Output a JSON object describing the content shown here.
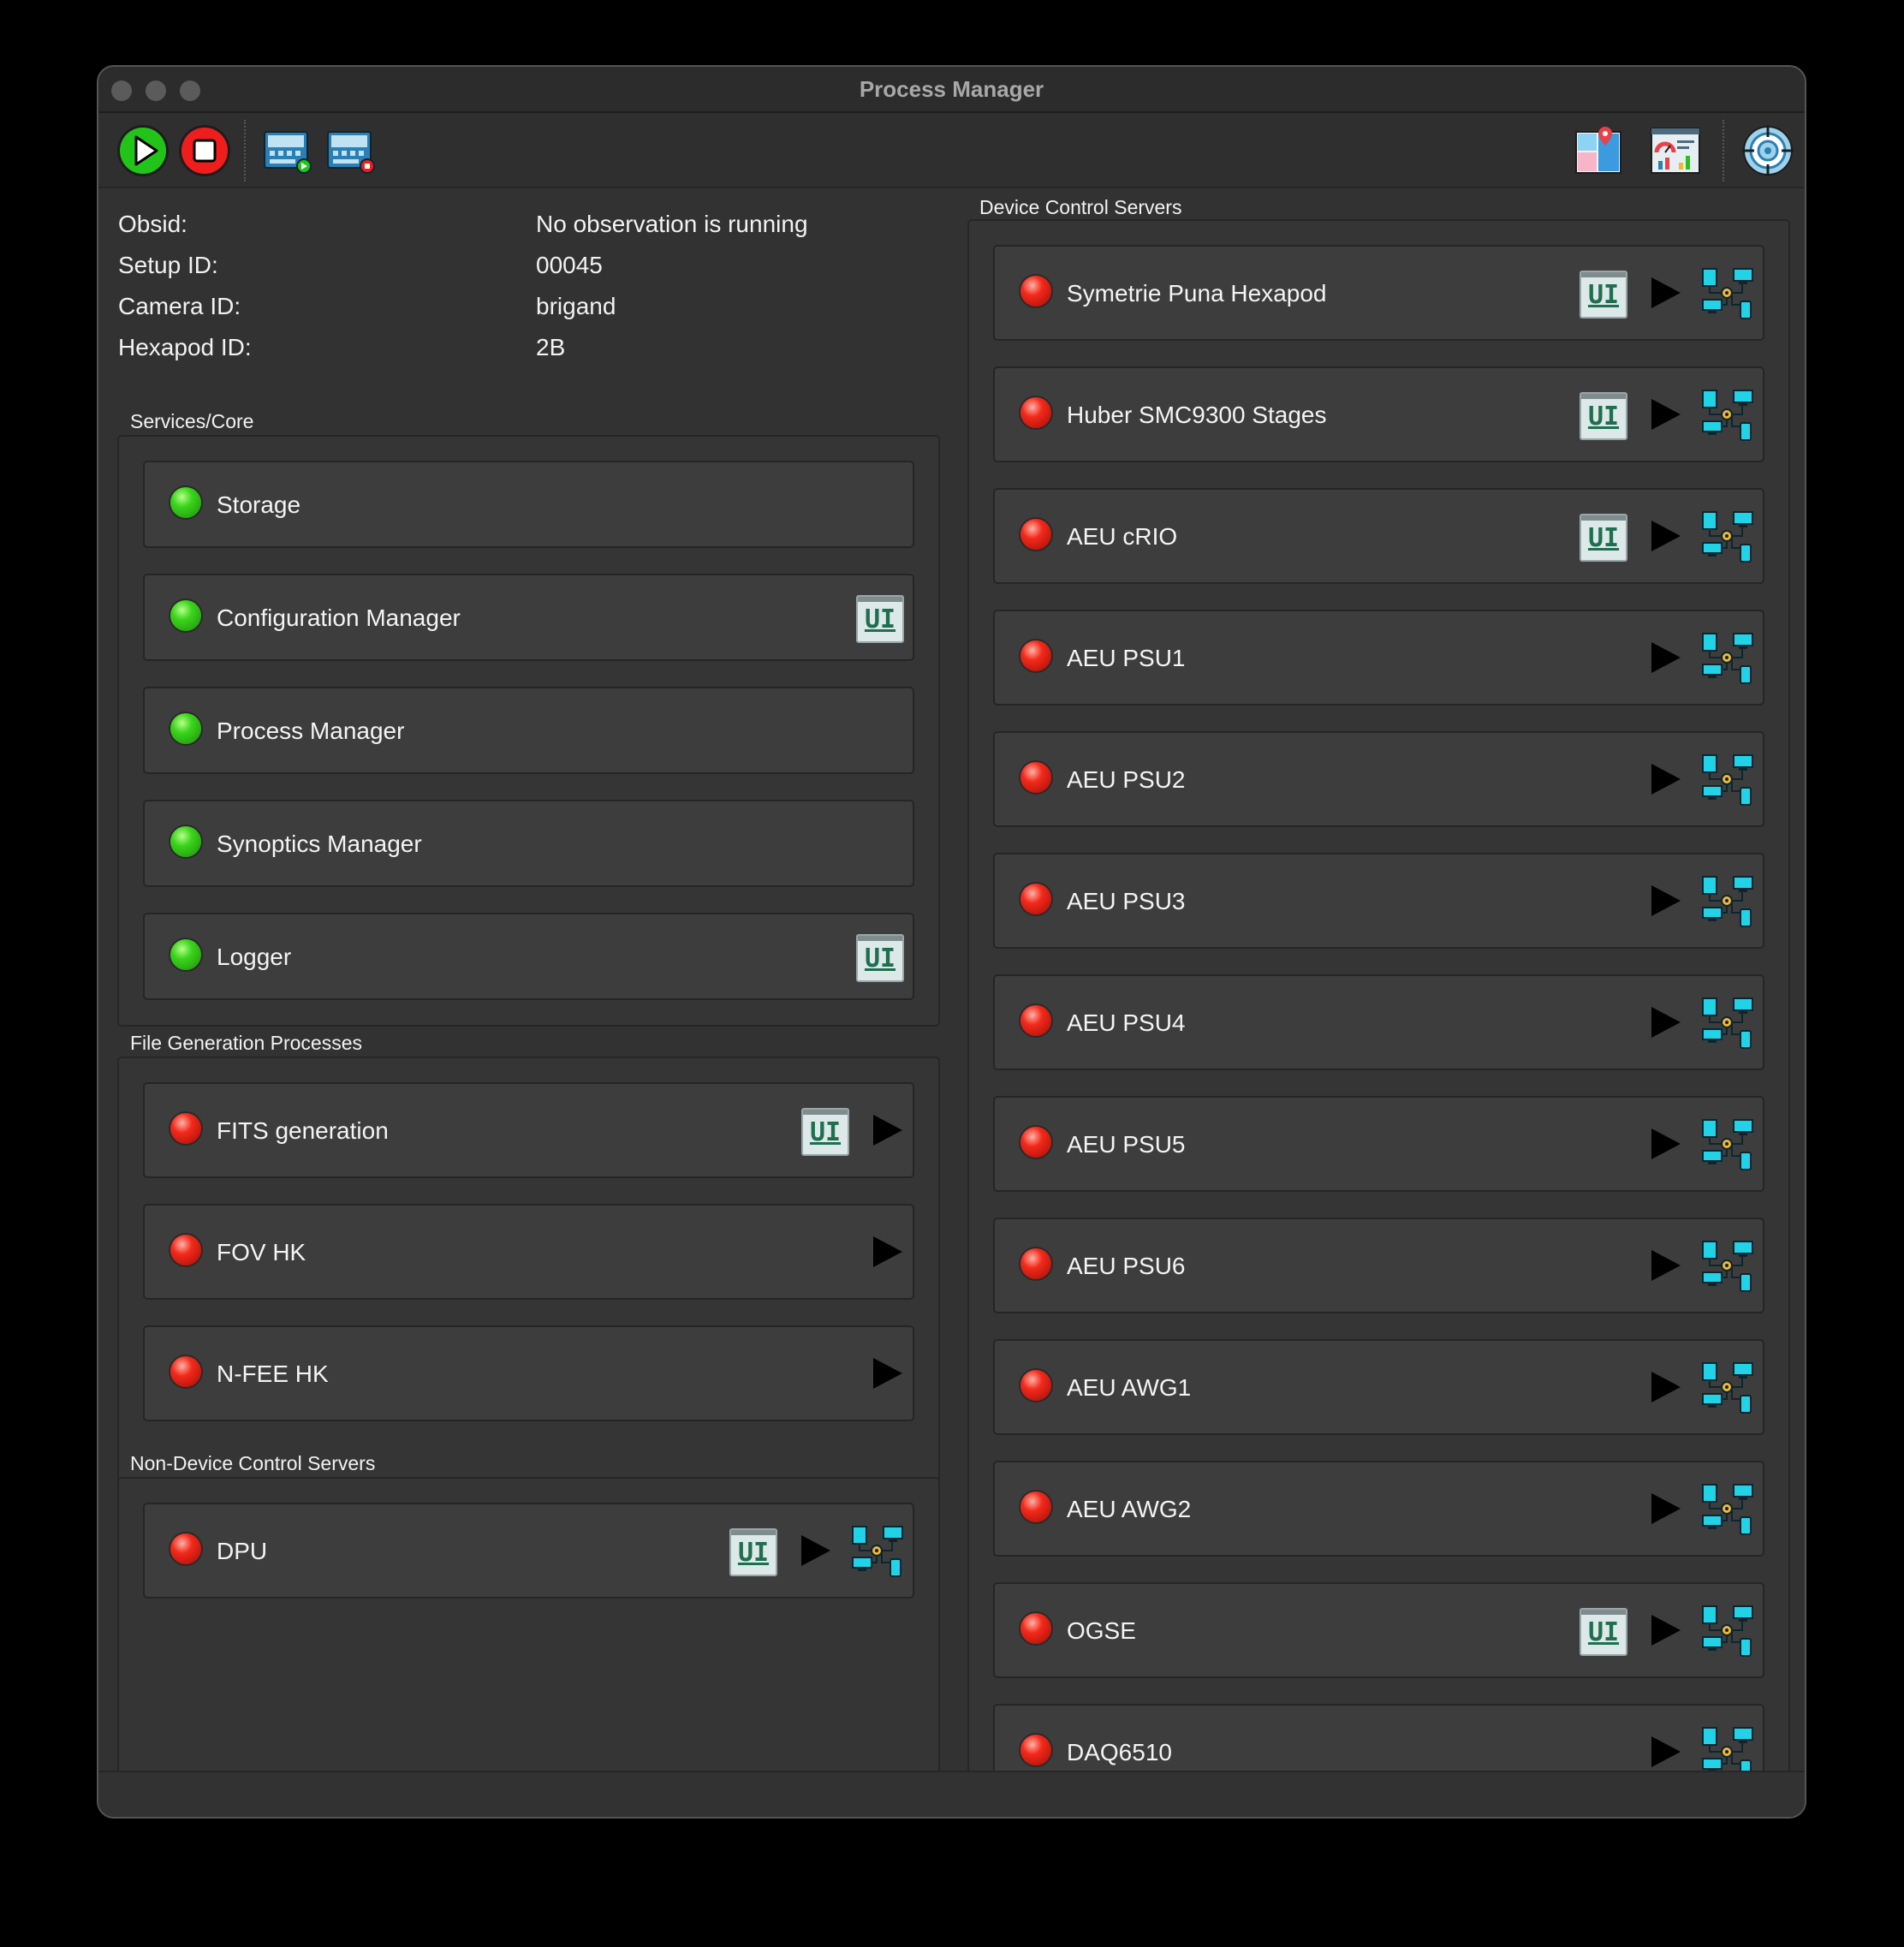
{
  "window": {
    "title": "Process Manager"
  },
  "toolbar": {
    "left_icons": [
      "play-icon",
      "stop-icon",
      "start-all-icon",
      "stop-all-icon"
    ],
    "right_icons": [
      "map-icon",
      "dashboard-icon",
      "target-icon"
    ]
  },
  "info": [
    {
      "label": "Obsid:",
      "value": "No observation is running"
    },
    {
      "label": "Setup ID:",
      "value": "00045"
    },
    {
      "label": "Camera ID:",
      "value": "brigand"
    },
    {
      "label": "Hexapod ID:",
      "value": "2B"
    }
  ],
  "groups": {
    "core": {
      "title": "Services/Core",
      "items": [
        {
          "label": "Storage",
          "status": "green",
          "ui": false,
          "play": false,
          "net": false
        },
        {
          "label": "Configuration Manager",
          "status": "green",
          "ui": true,
          "play": false,
          "net": false
        },
        {
          "label": "Process Manager",
          "status": "green",
          "ui": false,
          "play": false,
          "net": false
        },
        {
          "label": "Synoptics Manager",
          "status": "green",
          "ui": false,
          "play": false,
          "net": false
        },
        {
          "label": "Logger",
          "status": "green",
          "ui": true,
          "play": false,
          "net": false
        }
      ]
    },
    "filegen": {
      "title": "File Generation Processes",
      "items": [
        {
          "label": "FITS generation",
          "status": "red",
          "ui": true,
          "play": true,
          "net": false
        },
        {
          "label": "FOV HK",
          "status": "red",
          "ui": false,
          "play": true,
          "net": false
        },
        {
          "label": "N-FEE HK",
          "status": "red",
          "ui": false,
          "play": true,
          "net": false
        }
      ]
    },
    "nondevice": {
      "title": "Non-Device Control Servers",
      "items": [
        {
          "label": "DPU",
          "status": "red",
          "ui": true,
          "play": true,
          "net": true
        }
      ]
    },
    "devices": {
      "title": "Device Control Servers",
      "items": [
        {
          "label": "Symetrie Puna Hexapod",
          "status": "red",
          "ui": true,
          "play": true,
          "net": true
        },
        {
          "label": "Huber SMC9300 Stages",
          "status": "red",
          "ui": true,
          "play": true,
          "net": true
        },
        {
          "label": "AEU cRIO",
          "status": "red",
          "ui": true,
          "play": true,
          "net": true
        },
        {
          "label": "AEU PSU1",
          "status": "red",
          "ui": false,
          "play": true,
          "net": true
        },
        {
          "label": "AEU PSU2",
          "status": "red",
          "ui": false,
          "play": true,
          "net": true
        },
        {
          "label": "AEU PSU3",
          "status": "red",
          "ui": false,
          "play": true,
          "net": true
        },
        {
          "label": "AEU PSU4",
          "status": "red",
          "ui": false,
          "play": true,
          "net": true
        },
        {
          "label": "AEU PSU5",
          "status": "red",
          "ui": false,
          "play": true,
          "net": true
        },
        {
          "label": "AEU PSU6",
          "status": "red",
          "ui": false,
          "play": true,
          "net": true
        },
        {
          "label": "AEU AWG1",
          "status": "red",
          "ui": false,
          "play": true,
          "net": true
        },
        {
          "label": "AEU AWG2",
          "status": "red",
          "ui": false,
          "play": true,
          "net": true
        },
        {
          "label": "OGSE",
          "status": "red",
          "ui": true,
          "play": true,
          "net": true
        },
        {
          "label": "DAQ6510",
          "status": "red",
          "ui": false,
          "play": true,
          "net": true
        }
      ]
    }
  },
  "icon_text": {
    "ui": "UI"
  },
  "colors": {
    "status_green": "#3bd41c",
    "status_red": "#f22a1b",
    "play_green": "#22c41a",
    "stop_red": "#f01d1d"
  }
}
